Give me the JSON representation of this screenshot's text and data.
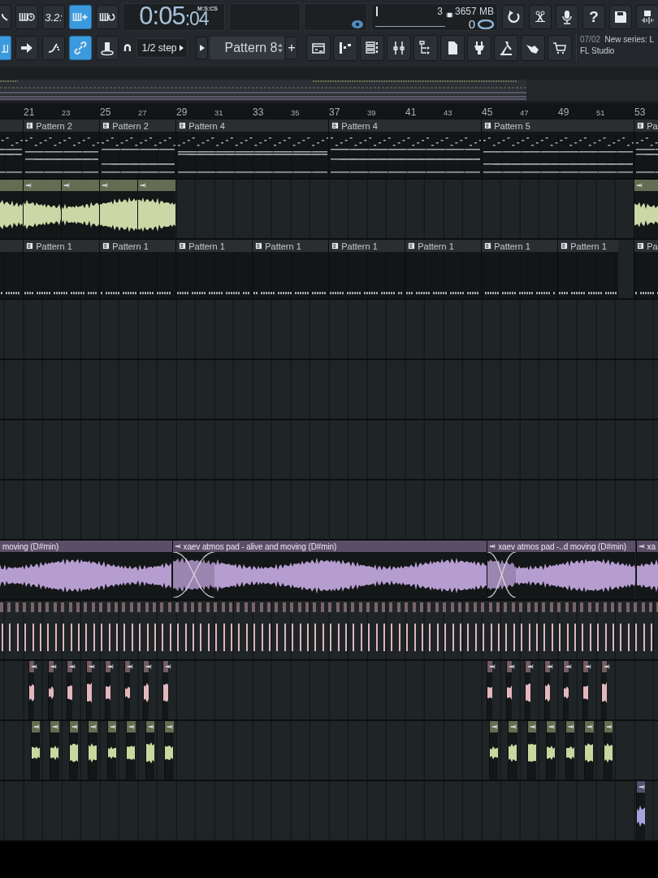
{
  "toolbar": {
    "row1_buttons": [
      {
        "kind": "curve",
        "on": false
      },
      {
        "kind": "keys-clock",
        "on": false
      },
      {
        "kind": "numeric",
        "label": "3.2:",
        "on": false
      },
      {
        "kind": "keys-plus",
        "on": true
      },
      {
        "kind": "keys-loop",
        "on": false
      }
    ],
    "time": {
      "main": "0:05",
      "fraction": ":04",
      "format": "M:S:CS"
    },
    "monitor": {
      "voices": "3",
      "memory": "3657 MB",
      "cpu": "0"
    },
    "system_buttons": [
      {
        "kind": "undo"
      },
      {
        "kind": "scissors"
      },
      {
        "kind": "mic"
      },
      {
        "kind": "text",
        "label": "?"
      },
      {
        "kind": "save"
      },
      {
        "kind": "save-audio"
      }
    ],
    "row2_buttons": [
      {
        "kind": "keys",
        "on": true
      },
      {
        "kind": "arrow",
        "on": false
      },
      {
        "kind": "slide",
        "on": false
      },
      {
        "kind": "link",
        "on": true
      },
      {
        "kind": "knob",
        "on": false
      }
    ],
    "snap": {
      "value": "1/2 step"
    },
    "pattern": {
      "value": "Pattern 8",
      "add": "+"
    },
    "windows": [
      {
        "kind": "playlist"
      },
      {
        "kind": "piano-roll"
      },
      {
        "kind": "channel-rack"
      },
      {
        "kind": "mixer"
      },
      {
        "kind": "browser"
      },
      {
        "kind": "file"
      },
      {
        "kind": "plugin"
      },
      {
        "kind": "pedal"
      },
      {
        "kind": "hand"
      },
      {
        "kind": "cart"
      }
    ],
    "news": {
      "date": "07/02",
      "headline": "New series: L",
      "source": "FL Studio"
    }
  },
  "playlist": {
    "ruler": [
      {
        "label": "21",
        "major": true
      },
      {
        "label": "23",
        "major": false
      },
      {
        "label": "25",
        "major": true
      },
      {
        "label": "27",
        "major": false
      },
      {
        "label": "29",
        "major": true
      },
      {
        "label": "31",
        "major": false
      },
      {
        "label": "33",
        "major": true
      },
      {
        "label": "35",
        "major": false
      },
      {
        "label": "37",
        "major": true
      },
      {
        "label": "39",
        "major": false
      },
      {
        "label": "41",
        "major": true
      },
      {
        "label": "43",
        "major": false
      },
      {
        "label": "45",
        "major": true
      },
      {
        "label": "47",
        "major": false
      },
      {
        "label": "49",
        "major": true
      },
      {
        "label": "51",
        "major": false
      },
      {
        "label": "53",
        "major": true
      }
    ],
    "tracks": [
      {
        "kind": "pattern",
        "clips": [
          {
            "label": "Pattern 2"
          },
          {
            "label": "Pattern 2"
          },
          {
            "label": "Pattern 4"
          },
          {
            "label": "Pattern 4"
          },
          {
            "label": "Pattern 5"
          },
          {
            "label": "Pa"
          }
        ]
      },
      {
        "kind": "audio",
        "color": "#cbd7a6"
      },
      {
        "kind": "pattern",
        "clips": [
          {
            "label": "Pattern 1"
          },
          {
            "label": "Pattern 1"
          },
          {
            "label": "Pattern 1"
          },
          {
            "label": "Pattern 1"
          },
          {
            "label": "Pattern 1"
          },
          {
            "label": "Pattern 1"
          },
          {
            "label": "Pattern 1"
          },
          {
            "label": "Pattern 1"
          },
          {
            "label": "Pa"
          }
        ]
      },
      {
        "kind": "empty"
      },
      {
        "kind": "empty"
      },
      {
        "kind": "empty"
      },
      {
        "kind": "empty"
      },
      {
        "kind": "audio",
        "color": "#b69dd0",
        "clips": [
          {
            "label": "moving (D#min)"
          },
          {
            "label": "xaev atmos pad - alive and moving (D#min)"
          },
          {
            "label": "xaev atmos pad -..d moving (D#min)"
          },
          {
            "label": "xa"
          }
        ]
      },
      {
        "kind": "ticks",
        "color": "#dcb6bb"
      },
      {
        "kind": "audio",
        "color": "#e3b8bd"
      },
      {
        "kind": "audio",
        "color": "#c8d9a0"
      },
      {
        "kind": "audio",
        "color": "#a7a2dc"
      }
    ]
  }
}
